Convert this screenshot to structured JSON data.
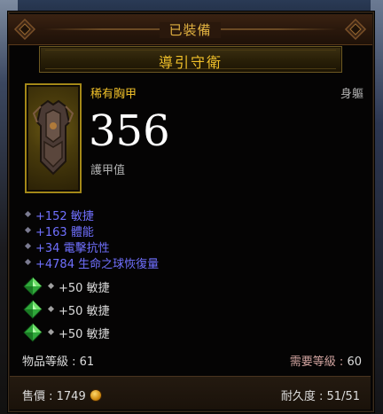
{
  "header": {
    "equipped_label": "已裝備"
  },
  "item": {
    "name": "導引守衛",
    "type": "稀有胸甲",
    "slot": "身軀",
    "armor_value": "356",
    "armor_label": "護甲值",
    "portrait_icon": "chest-armor-icon"
  },
  "stats": [
    "+152 敏捷",
    "+163 體能",
    "+34 電擊抗性",
    "+4784 生命之球恢復量"
  ],
  "gems": [
    {
      "icon": "emerald-gem-icon",
      "text": "+50 敏捷"
    },
    {
      "icon": "emerald-gem-icon",
      "text": "+50 敏捷"
    },
    {
      "icon": "emerald-gem-icon",
      "text": "+50 敏捷"
    }
  ],
  "levels": {
    "item_level_label": "物品等級 : 61",
    "required_label": "需要等級 : ",
    "required_value": "60"
  },
  "footer": {
    "sell_label": "售價 : 1749",
    "gold_icon": "gold-coin-icon",
    "durability_label": "耐久度 :  51/51"
  },
  "colors": {
    "rare_gold": "#f0c02a",
    "magic_blue": "#7070ff",
    "header_orange": "#e0b040",
    "required_red": "#d2a4a0"
  }
}
